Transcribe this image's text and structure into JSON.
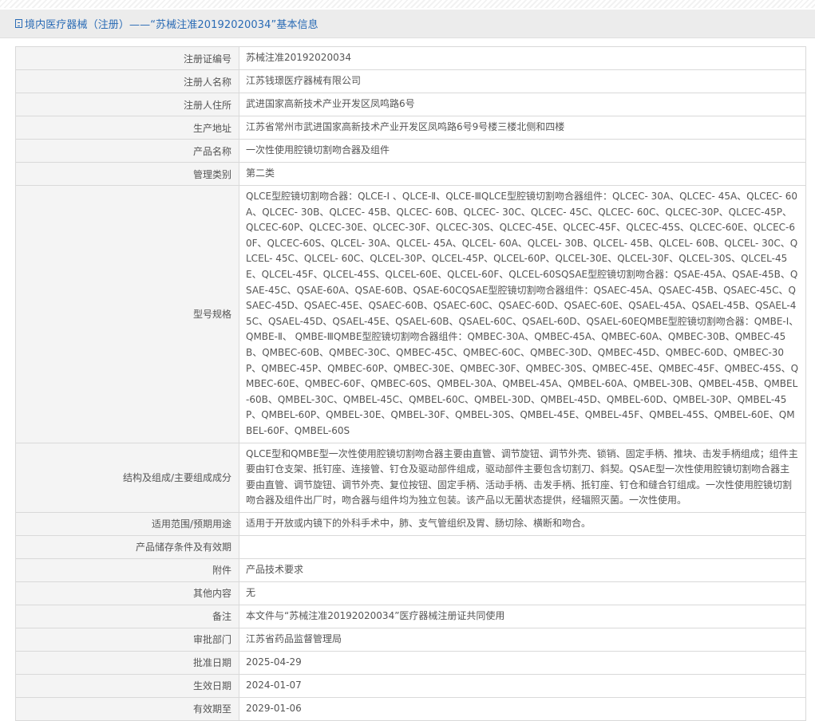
{
  "header": {
    "title": "境内医疗器械（注册）——“苏械注准20192020034”基本信息"
  },
  "rows": [
    {
      "label": "注册证编号",
      "value": "苏械注准20192020034"
    },
    {
      "label": "注册人名称",
      "value": "江苏钱璟医疗器械有限公司"
    },
    {
      "label": "注册人住所",
      "value": "武进国家高新技术产业开发区凤鸣路6号"
    },
    {
      "label": "生产地址",
      "value": "江苏省常州市武进国家高新技术产业开发区凤鸣路6号9号楼三楼北侧和四楼"
    },
    {
      "label": "产品名称",
      "value": "一次性使用腔镜切割吻合器及组件"
    },
    {
      "label": "管理类别",
      "value": "第二类"
    },
    {
      "label": "型号规格",
      "value": "QLCE型腔镜切割吻合器：QLCE-Ⅰ 、QLCE-Ⅱ、QLCE-ⅢQLCE型腔镜切割吻合器组件：QLCEC- 30A、QLCEC- 45A、QLCEC- 60A、QLCEC- 30B、QLCEC- 45B、QLCEC- 60B、QLCEC- 30C、QLCEC- 45C、QLCEC- 60C、QLCEC-30P、QLCEC-45P、QLCEC-60P、QLCEC-30E、QLCEC-30F、QLCEC-30S、QLCEC-45E、QLCEC-45F、QLCEC-45S、QLCEC-60E、QLCEC-60F、QLCEC-60S、QLCEL- 30A、QLCEL- 45A、QLCEL- 60A、QLCEL- 30B、QLCEL- 45B、QLCEL- 60B、QLCEL- 30C、QLCEL- 45C、QLCEL- 60C、QLCEL-30P、QLCEL-45P、QLCEL-60P、QLCEL-30E、QLCEL-30F、QLCEL-30S、QLCEL-45E、QLCEL-45F、QLCEL-45S、QLCEL-60E、QLCEL-60F、QLCEL-60SQSAE型腔镜切割吻合器：QSAE-45A、QSAE-45B、QSAE-45C、QSAE-60A、QSAE-60B、QSAE-60CQSAE型腔镜切割吻合器组件：QSAEC-45A、QSAEC-45B、QSAEC-45C、QSAEC-45D、QSAEC-45E、QSAEC-60B、QSAEC-60C、QSAEC-60D、QSAEC-60E、QSAEL-45A、QSAEL-45B、QSAEL-45C、QSAEL-45D、QSAEL-45E、QSAEL-60B、QSAEL-60C、QSAEL-60D、QSAEL-60EQMBE型腔镜切割吻合器：QMBE-Ⅰ、 QMBE-Ⅱ、 QMBE-ⅢQMBE型腔镜切割吻合器组件：QMBEC-30A、QMBEC-45A、QMBEC-60A、QMBEC-30B、QMBEC-45B、QMBEC-60B、QMBEC-30C、QMBEC-45C、QMBEC-60C、QMBEC-30D、QMBEC-45D、QMBEC-60D、QMBEC-30P、QMBEC-45P、QMBEC-60P、QMBEC-30E、QMBEC-30F、QMBEC-30S、QMBEC-45E、QMBEC-45F、QMBEC-45S、QMBEC-60E、QMBEC-60F、QMBEC-60S、QMBEL-30A、QMBEL-45A、QMBEL-60A、QMBEL-30B、QMBEL-45B、QMBEL-60B、QMBEL-30C、QMBEL-45C、QMBEL-60C、QMBEL-30D、QMBEL-45D、QMBEL-60D、QMBEL-30P、QMBEL-45P、QMBEL-60P、QMBEL-30E、QMBEL-30F、QMBEL-30S、QMBEL-45E、QMBEL-45F、QMBEL-45S、QMBEL-60E、QMBEL-60F、QMBEL-60S"
    },
    {
      "label": "结构及组成/主要组成成分",
      "value": "QLCE型和QMBE型一次性使用腔镜切割吻合器主要由直管、调节旋钮、调节外壳、锁销、固定手柄、推块、击发手柄组成；组件主要由钉仓支架、抵钉座、连接管、钉仓及驱动部件组成，驱动部件主要包含切割刀、斜契。QSAE型一次性使用腔镜切割吻合器主要由直管、调节旋钮、调节外壳、复位按钮、固定手柄、活动手柄、击发手柄、抵钉座、钉仓和缝合钉组成。一次性使用腔镜切割吻合器及组件出厂时，吻合器与组件均为独立包装。该产品以无菌状态提供，经辐照灭菌。一次性使用。"
    },
    {
      "label": "适用范围/预期用途",
      "value": "适用于开放或内镜下的外科手术中，肺、支气管组织及胃、肠切除、横断和吻合。"
    },
    {
      "label": "产品储存条件及有效期",
      "value": ""
    },
    {
      "label": "附件",
      "value": "产品技术要求"
    },
    {
      "label": "其他内容",
      "value": "无"
    },
    {
      "label": "备注",
      "value": "本文件与“苏械注准20192020034”医疗器械注册证共同使用"
    },
    {
      "label": "审批部门",
      "value": "江苏省药品监督管理局"
    },
    {
      "label": "批准日期",
      "value": "2025-04-29"
    },
    {
      "label": "生效日期",
      "value": "2024-01-07"
    },
    {
      "label": "有效期至",
      "value": "2029-01-06"
    }
  ]
}
